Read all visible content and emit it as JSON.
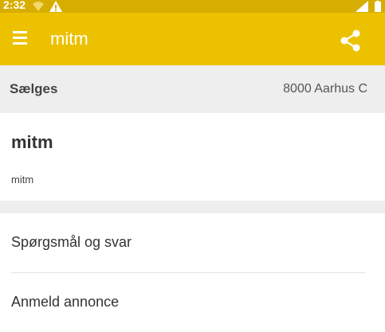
{
  "status_bar": {
    "time": "2:32",
    "icons": [
      "wifi-icon",
      "warning-icon",
      "signal-icon",
      "battery-icon"
    ]
  },
  "app_bar": {
    "title": "mitm",
    "menu_icon": "hamburger-menu-icon",
    "share_icon": "share-icon",
    "background_color": "#ecc100"
  },
  "info_bar": {
    "status": "Sælges",
    "location": "8000 Aarhus C"
  },
  "listing": {
    "title": "mitm",
    "description": "mitm"
  },
  "menu": {
    "items": [
      {
        "label": "Spørgsmål og svar"
      },
      {
        "label": "Anmeld annonce"
      }
    ]
  }
}
